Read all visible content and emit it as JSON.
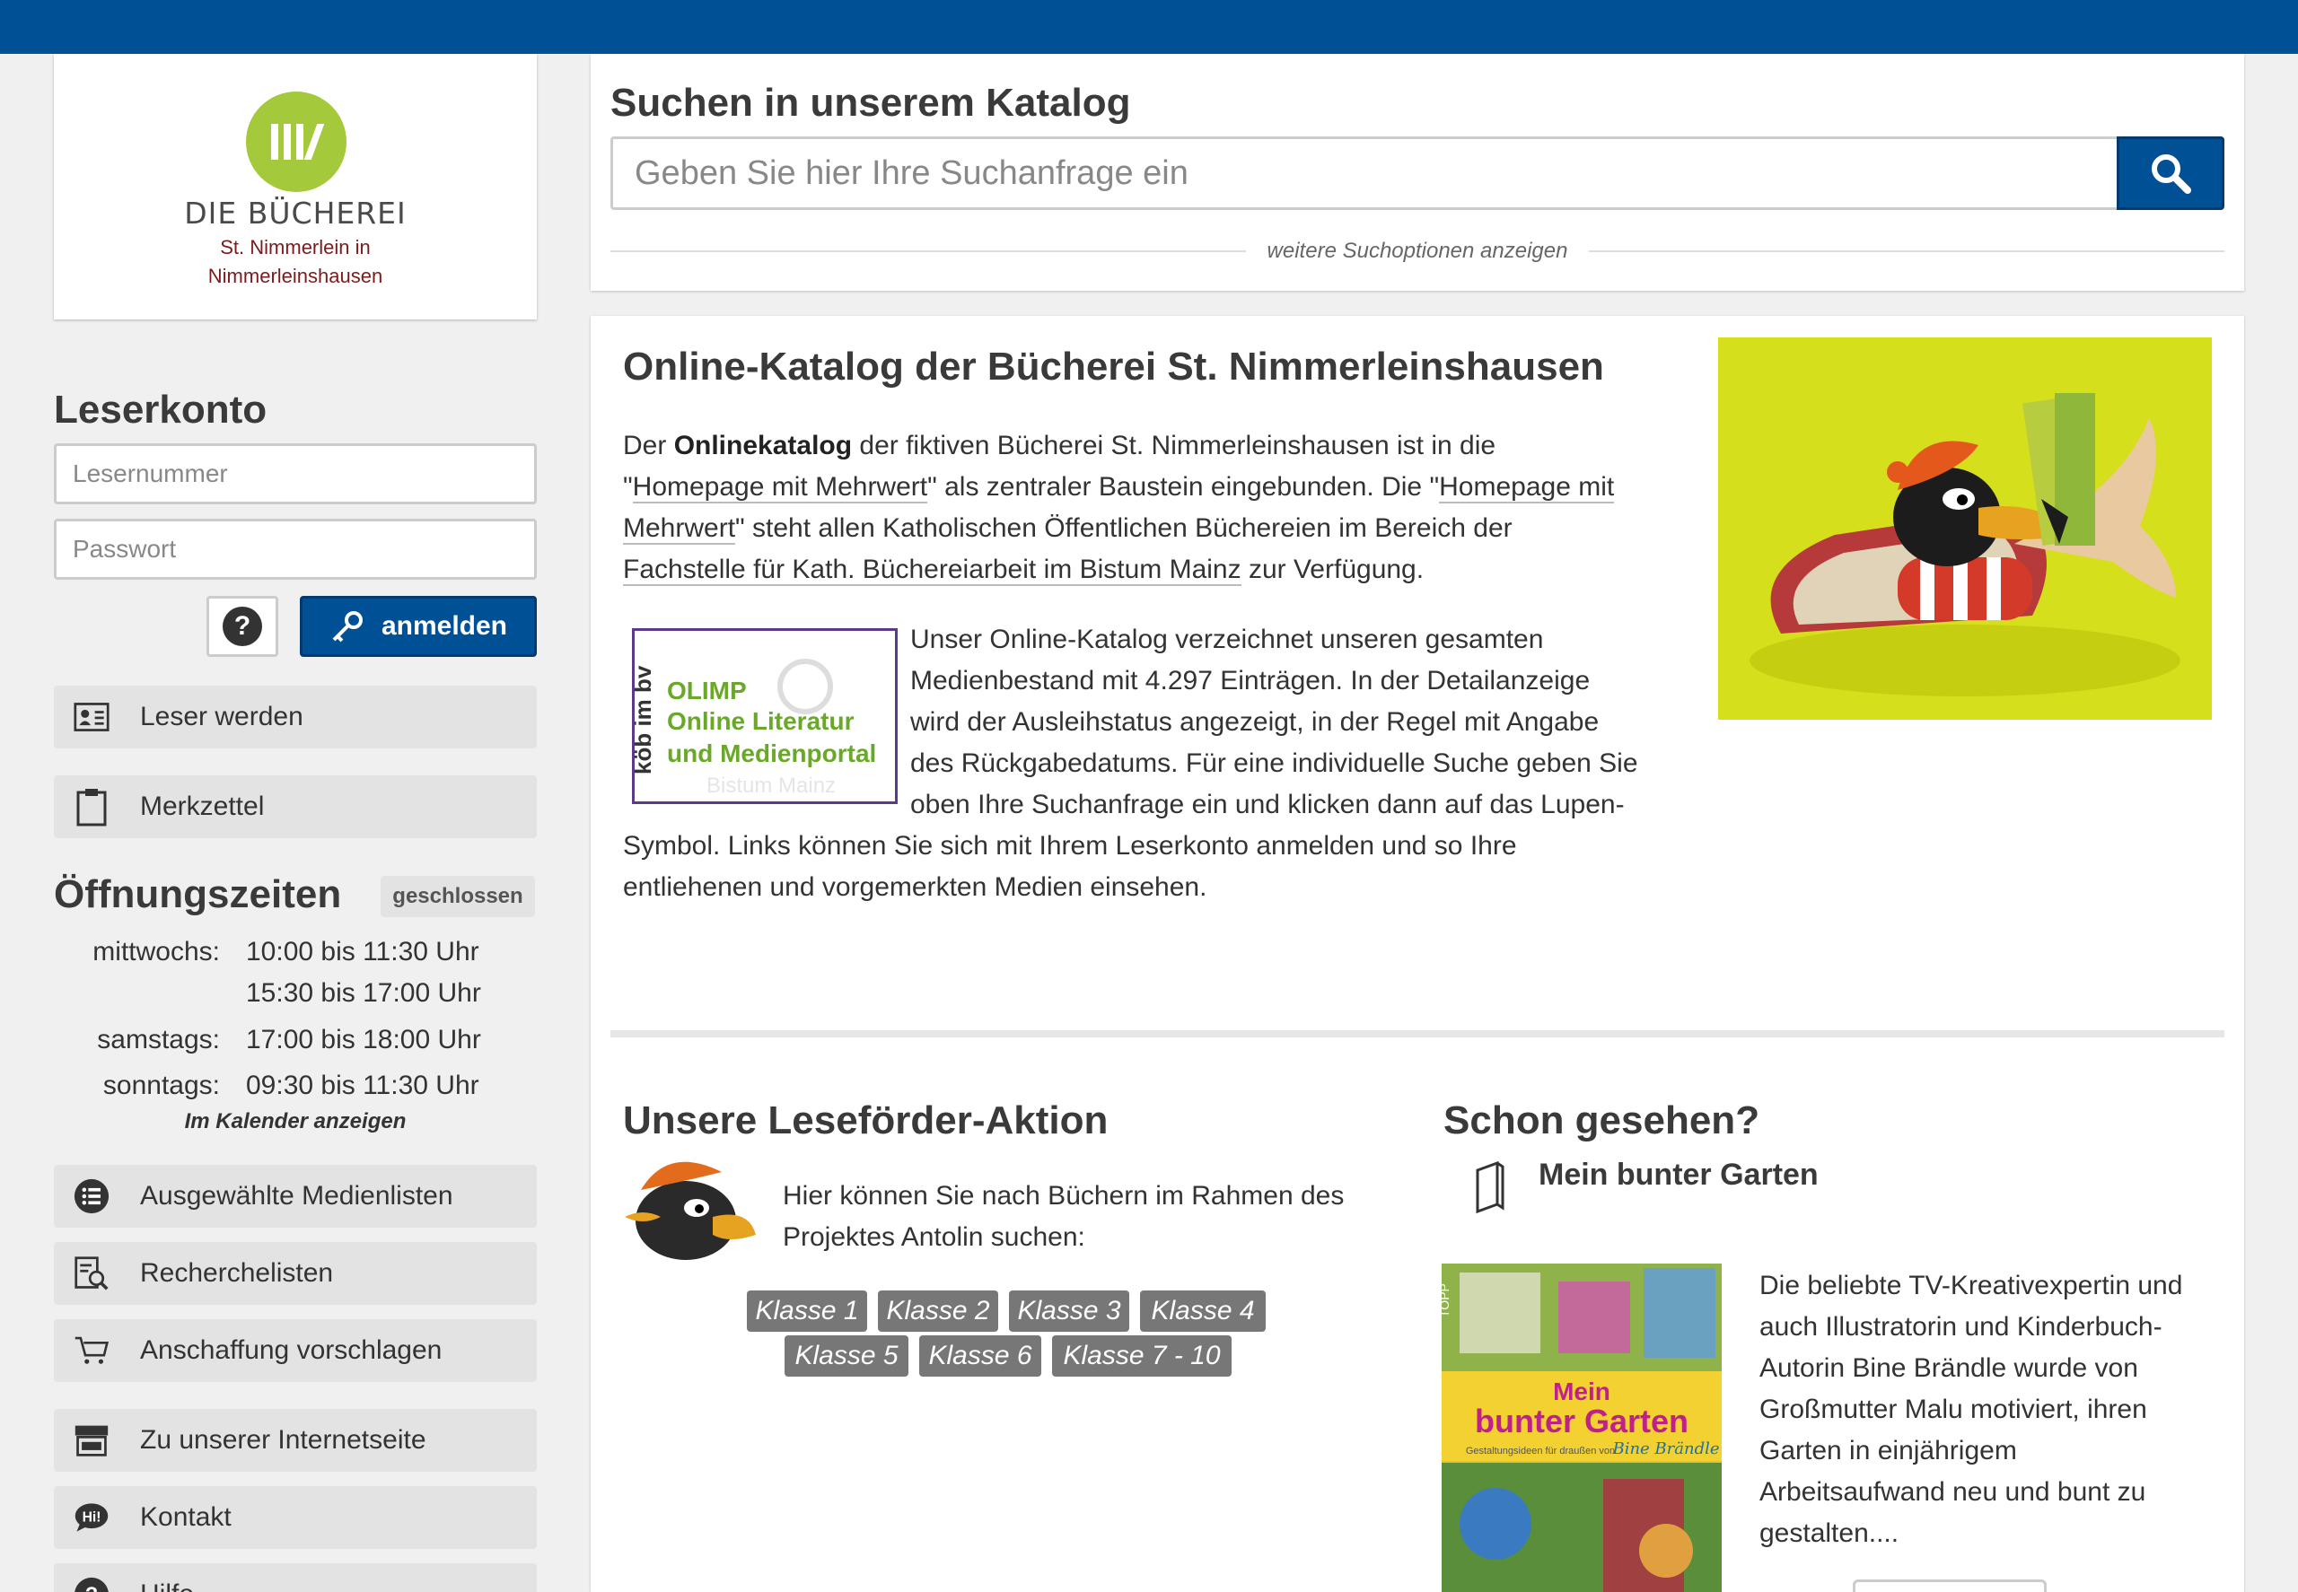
{
  "colors": {
    "brand_blue": "#005095",
    "logo_green": "#a4c93b",
    "logo_red": "#7b1b1e"
  },
  "logo": {
    "name": "DIE BÜCHEREI",
    "sub_line1": "St. Nimmerlein in",
    "sub_line2": "Nimmerleinshausen"
  },
  "account": {
    "title": "Leserkonto",
    "reader_placeholder": "Lesernummer",
    "password_placeholder": "Passwort",
    "help_symbol": "?",
    "login_label": "anmelden"
  },
  "sidebar_top": [
    {
      "label": "Leser werden",
      "icon": "id-card-icon"
    },
    {
      "label": "Merkzettel",
      "icon": "clipboard-icon"
    }
  ],
  "hours": {
    "title": "Öffnungszeiten",
    "status": "geschlossen",
    "rows": [
      {
        "day": "mittwochs:",
        "time": "10:00 bis 11:30 Uhr"
      },
      {
        "day": "",
        "time": "15:30 bis 17:00 Uhr"
      },
      {
        "day": "samstags:",
        "time": "17:00 bis 18:00 Uhr"
      },
      {
        "day": "sonntags:",
        "time": "09:30 bis 11:30 Uhr"
      }
    ],
    "calendar_link": "Im Kalender anzeigen"
  },
  "sidebar_bottom": [
    {
      "label": "Ausgewählte Medienlisten",
      "icon": "list-icon"
    },
    {
      "label": "Recherchelisten",
      "icon": "research-list-icon"
    },
    {
      "label": "Anschaffung vorschlagen",
      "icon": "cart-icon"
    },
    {
      "label": "Zu unserer Internetseite",
      "icon": "store-icon"
    },
    {
      "label": "Kontakt",
      "icon": "chat-icon"
    },
    {
      "label": "Hilfe",
      "icon": "help-icon"
    }
  ],
  "search": {
    "title": "Suchen in unserem Katalog",
    "placeholder": "Geben Sie hier Ihre Suchanfrage ein",
    "more_options": "weitere Suchoptionen anzeigen"
  },
  "intro": {
    "title": "Online-Katalog der Bücherei St. Nimmerleinshausen",
    "p1_a": "Der ",
    "p1_bold": "Onlinekatalog",
    "p1_b": " der fiktiven Bücherei St. Nimmerleinshausen ist in die",
    "p1_c": "\"",
    "p1_link1": "Homepage mit Mehrwert",
    "p1_d": "\" als zentraler Baustein eingebunden. Die \"",
    "p1_link2a": "Homepage mit",
    "p1_link2b": "Mehrwert",
    "p1_e": "\" steht allen Katholischen Öffentlichen Büchereien im Bereich der",
    "p1_link3": "Fachstelle für Kath. Büchereiarbeit im Bistum Mainz",
    "p1_f": " zur Verfügung.",
    "p2_lines": [
      "Unser Online-Katalog verzeichnet unseren gesamten",
      "Medienbestand mit 4.297 Einträgen. In der Detailanzeige",
      "wird der Ausleihstatus angezeigt, in der Regel mit Angabe",
      "des Rückgabedatums. Für eine individuelle Suche geben Sie",
      "oben Ihre Suchanfrage ein und klicken dann auf das Lupen-"
    ],
    "p2_tail_lines": [
      "Symbol. Links können Sie sich mit Ihrem Leserkonto anmelden und so Ihre",
      "entliehenen und vorgemerkten Medien einsehen."
    ],
    "olimp": {
      "brand": "köb im bv",
      "line1": "OLIMP",
      "line2": "Online Literatur",
      "line3": "und Medienportal",
      "faint": "Bistum Mainz"
    }
  },
  "reading": {
    "title": "Unsere Leseförder-Aktion",
    "text_line1": "Hier können Sie nach Büchern im Rahmen des",
    "text_line2": "Projektes Antolin suchen:",
    "classes": [
      "Klasse 1",
      "Klasse 2",
      "Klasse 3",
      "Klasse 4",
      "Klasse 5",
      "Klasse 6",
      "Klasse 7 - 10"
    ]
  },
  "seen": {
    "title": "Schon gesehen?",
    "book_title": "Mein bunter Garten",
    "cover": {
      "publisher": "TOPP",
      "t1": "Mein",
      "t2": "bunter Garten",
      "sub": "Gestaltungsideen für draußen von",
      "author": "Bine Brändle"
    },
    "desc_lines": [
      "Die beliebte TV-Kreativexpertin und",
      "auch Illustratorin und Kinderbuch-",
      "Autorin Bine Brändle wurde von",
      "Großmutter Malu motiviert, ihren",
      "Garten in einjährigem",
      "Arbeitsaufwand neu und bunt zu",
      "gestalten...."
    ]
  }
}
